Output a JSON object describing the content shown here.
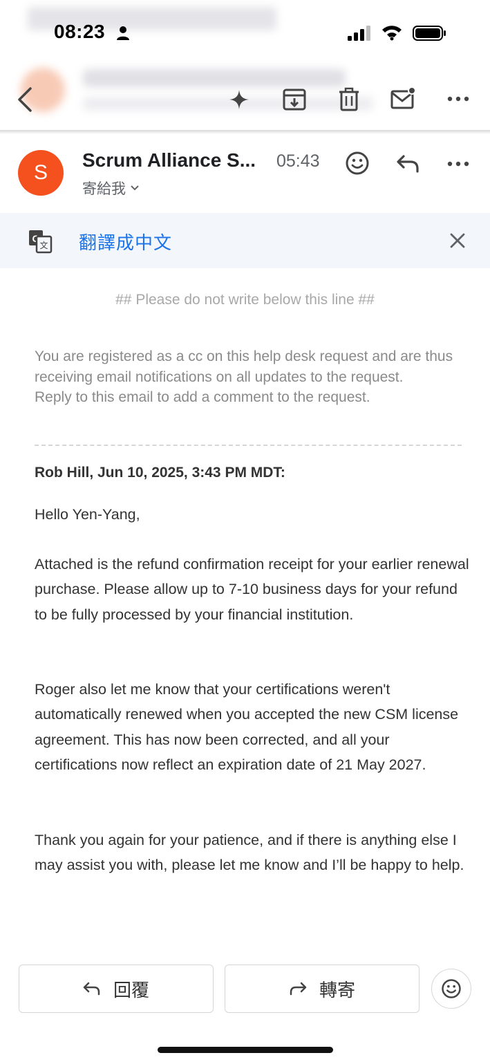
{
  "status_bar": {
    "time": "08:23"
  },
  "toolbar": {
    "icons": [
      "back-icon",
      "sparkle-icon",
      "archive-icon",
      "trash-icon",
      "mark-unread-icon",
      "more-icon"
    ]
  },
  "message": {
    "avatar_letter": "S",
    "avatar_color": "#f4511e",
    "sender": "Scrum Alliance S...",
    "time": "05:43",
    "recipient": "寄給我"
  },
  "translate": {
    "link": "翻譯成中文",
    "link_color": "#1a73e8"
  },
  "body": {
    "marker": "## Please do not write below this line ##",
    "notice_line1": "You are registered as a cc on this help desk request and are thus receiving email notifications on all updates to the request.",
    "notice_line2": "Reply to this email to add a comment to the request.",
    "author_line": "Rob Hill, Jun 10, 2025, 3:43 PM MDT:",
    "greeting": "Hello Yen-Yang,",
    "para1": "Attached is the refund confirmation receipt for your earlier renewal purchase. Please allow up to 7-10 business days for your refund to be fully processed by your financial institution.",
    "para2": "Roger also let me know that your certifications weren't automatically renewed when you accepted the new CSM license agreement. This has now been corrected, and all your certifications now reflect an expiration date of 21 May 2027.",
    "para3": "Thank you again for your patience, and if there is anything else I may assist you with, please let me know and I’ll be happy to help."
  },
  "actions": {
    "reply_label": "回覆",
    "forward_label": "轉寄"
  }
}
